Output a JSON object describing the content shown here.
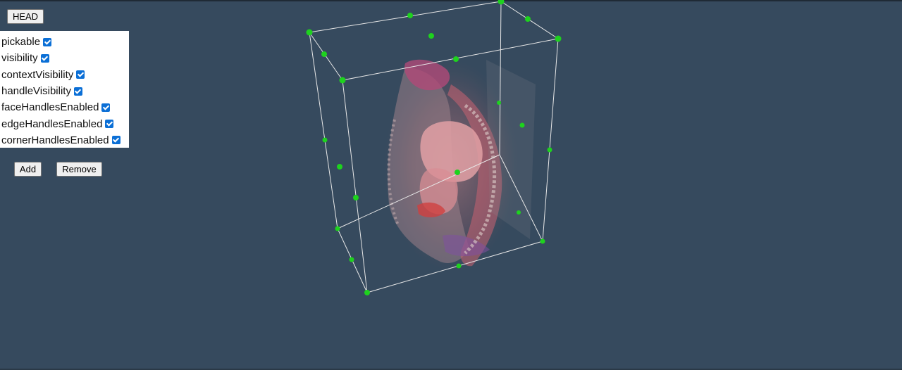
{
  "head_button": {
    "label": "HEAD"
  },
  "options": [
    {
      "label": "pickable",
      "checked": true
    },
    {
      "label": "visibility",
      "checked": true
    },
    {
      "label": "contextVisibility",
      "checked": true
    },
    {
      "label": "handleVisibility",
      "checked": true
    },
    {
      "label": "faceHandlesEnabled",
      "checked": true
    },
    {
      "label": "edgeHandlesEnabled",
      "checked": true
    },
    {
      "label": "cornerHandlesEnabled",
      "checked": true
    }
  ],
  "buttons": {
    "add": "Add",
    "remove": "Remove"
  },
  "colors": {
    "background": "#364a5e",
    "handle": "#1ed21e",
    "box_edge": "#e8e8e8",
    "checkbox": "#0b6fd6"
  }
}
